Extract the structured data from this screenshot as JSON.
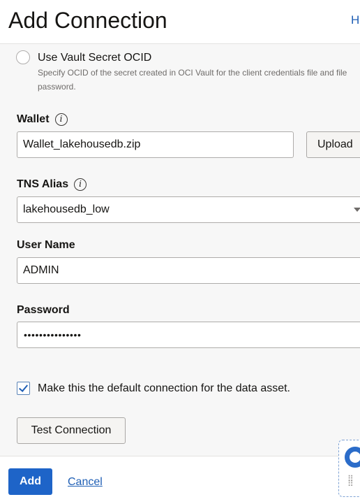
{
  "header": {
    "title": "Add Connection",
    "help_link": "H"
  },
  "vault_option": {
    "label": "Use Vault Secret OCID",
    "description": "Specify OCID of the secret created in OCI Vault for the client credentials file and file password."
  },
  "wallet": {
    "label": "Wallet",
    "value": "Wallet_lakehousedb.zip",
    "upload_label": "Upload"
  },
  "tns_alias": {
    "label": "TNS Alias",
    "value": "lakehousedb_low"
  },
  "user_name": {
    "label": "User Name",
    "value": "ADMIN"
  },
  "password": {
    "label": "Password",
    "masked_value": "•••••••••••••••"
  },
  "default_connection": {
    "label": "Make this the default connection for the data asset.",
    "checked": true
  },
  "test_connection_label": "Test Connection",
  "footer": {
    "add_label": "Add",
    "cancel_label": "Cancel"
  },
  "colors": {
    "primary": "#1e64c8",
    "link": "#1f5fb5",
    "background": "#f7f7f7"
  }
}
